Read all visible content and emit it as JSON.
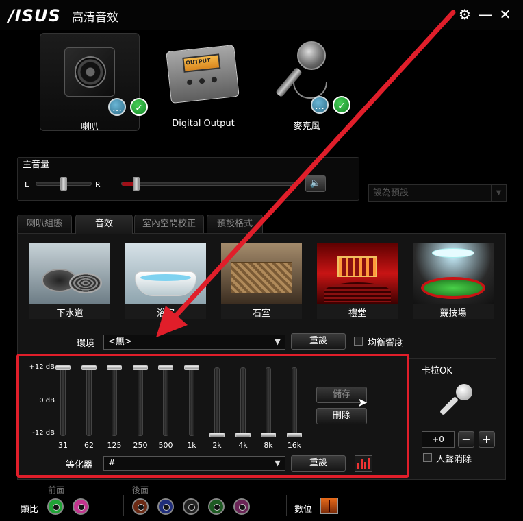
{
  "window": {
    "logo": "/ISUS",
    "title": "高清音效",
    "gear": "⚙",
    "minimize": "—",
    "close": "✕"
  },
  "devices": [
    {
      "label": "喇叭",
      "selected": true
    },
    {
      "label": "Digital Output",
      "screen_text": "OUTPUT"
    },
    {
      "label": "麥克風"
    }
  ],
  "master_volume": {
    "title": "主音量",
    "left_label": "L",
    "right_label": "R",
    "balance": 0.5,
    "level": 0.08,
    "mute_icon": "🔈"
  },
  "default_select": {
    "value": "設為預設"
  },
  "tabs": [
    "喇叭組態",
    "音效",
    "室內空間校正",
    "預設格式"
  ],
  "active_tab": 1,
  "environments": [
    {
      "label": "下水道",
      "icon": "sewer-icon"
    },
    {
      "label": "浴室",
      "icon": "bathroom-icon"
    },
    {
      "label": "石室",
      "icon": "stone-room-icon"
    },
    {
      "label": "禮堂",
      "icon": "auditorium-icon"
    },
    {
      "label": "競技場",
      "icon": "arena-icon"
    }
  ],
  "environment_row": {
    "label": "環境",
    "value": "<無>",
    "reset": "重設",
    "equalize": "均衡響度"
  },
  "equalizer": {
    "db_top": "+12 dB",
    "db_mid": "0 dB",
    "db_bottom": "-12 dB",
    "bands": [
      {
        "freq": "31",
        "db": 12
      },
      {
        "freq": "62",
        "db": 12
      },
      {
        "freq": "125",
        "db": 12
      },
      {
        "freq": "250",
        "db": 12
      },
      {
        "freq": "500",
        "db": 12
      },
      {
        "freq": "1k",
        "db": 12
      },
      {
        "freq": "2k",
        "db": -12
      },
      {
        "freq": "4k",
        "db": -12
      },
      {
        "freq": "8k",
        "db": -12
      },
      {
        "freq": "16k",
        "db": -12
      }
    ],
    "save": "儲存",
    "delete": "刪除",
    "label": "等化器",
    "value": "#",
    "reset": "重設"
  },
  "karaoke": {
    "title": "卡拉OK",
    "value": "+0",
    "minus": "−",
    "plus": "+",
    "vocal_cancel": "人聲消除"
  },
  "jacks": {
    "front_label": "前面",
    "rear_label": "後面",
    "analog_label": "類比",
    "digital_label": "數位",
    "front_colors": [
      "#1fa336",
      "#c2348e"
    ],
    "rear_colors": [
      "#6b2a14",
      "#1f2d7a",
      "#222222",
      "#1d5a22",
      "#6a2456"
    ]
  },
  "colors": {
    "highlight": "#e01e2a"
  }
}
